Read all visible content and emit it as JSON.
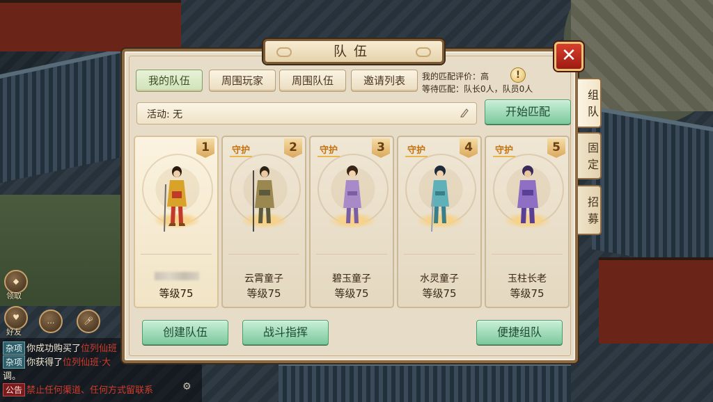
{
  "dialog": {
    "title": "队伍",
    "close_glyph": "✕"
  },
  "tabs": [
    {
      "label": "我的队伍",
      "active": true
    },
    {
      "label": "周围玩家",
      "active": false
    },
    {
      "label": "周围队伍",
      "active": false
    },
    {
      "label": "邀请列表",
      "active": false
    }
  ],
  "match_info": {
    "rating": "我的匹配评价：高",
    "waiting": "等待匹配：队长0人，队员0人",
    "icon": "warning-icon",
    "icon_glyph": "!"
  },
  "activity": {
    "label": "活动: 无",
    "icon": "pencil-icon"
  },
  "start_match_label": "开始匹配",
  "members": [
    {
      "slot": "1",
      "badge": "",
      "name": "",
      "name_hidden": true,
      "level": "等级75",
      "colors": {
        "body": "#d9a228",
        "accent": "#c0392b",
        "hair": "#2a1a10"
      }
    },
    {
      "slot": "2",
      "badge": "守护",
      "name": "云霄童子",
      "name_hidden": false,
      "level": "等级75",
      "colors": {
        "body": "#9a8850",
        "accent": "#5c5a3c",
        "hair": "#2a2418"
      }
    },
    {
      "slot": "3",
      "badge": "守护",
      "name": "碧玉童子",
      "name_hidden": false,
      "level": "等级75",
      "colors": {
        "body": "#a88ac8",
        "accent": "#7a5ea3",
        "hair": "#3a2418"
      }
    },
    {
      "slot": "4",
      "badge": "守护",
      "name": "水灵童子",
      "name_hidden": false,
      "level": "等级75",
      "colors": {
        "body": "#5fb0b8",
        "accent": "#3a7f88",
        "hair": "#1f2a3a"
      }
    },
    {
      "slot": "5",
      "badge": "守护",
      "name": "玉柱长老",
      "name_hidden": false,
      "level": "等级75",
      "colors": {
        "body": "#8e6fc4",
        "accent": "#5a3f96",
        "hair": "#3a2a5a"
      }
    }
  ],
  "actions": {
    "create_team": "创建队伍",
    "battle_command": "战斗指挥",
    "quick_team": "便捷组队"
  },
  "side_tabs": [
    {
      "label": "组队",
      "active": true
    },
    {
      "label": "固定",
      "active": false
    },
    {
      "label": "招募",
      "active": false
    }
  ],
  "hud": {
    "claim_label": "领取",
    "friend_label": "好友"
  },
  "chat": [
    {
      "tag": "杂项",
      "text": "你成功购买了",
      "highlight": "位列仙班"
    },
    {
      "tag": "杂项",
      "text": "你获得了",
      "highlight": "位列仙班·大"
    },
    {
      "tag": "",
      "text": "调。",
      "highlight": ""
    },
    {
      "tag": "公告",
      "text": "",
      "highlight": "禁止任何渠道、任何方式留联系"
    }
  ],
  "colors": {
    "panel": "#e7dcc7",
    "frame": "#8a6a45",
    "accent_green": "#7cc89c",
    "close_red": "#c0301f"
  }
}
